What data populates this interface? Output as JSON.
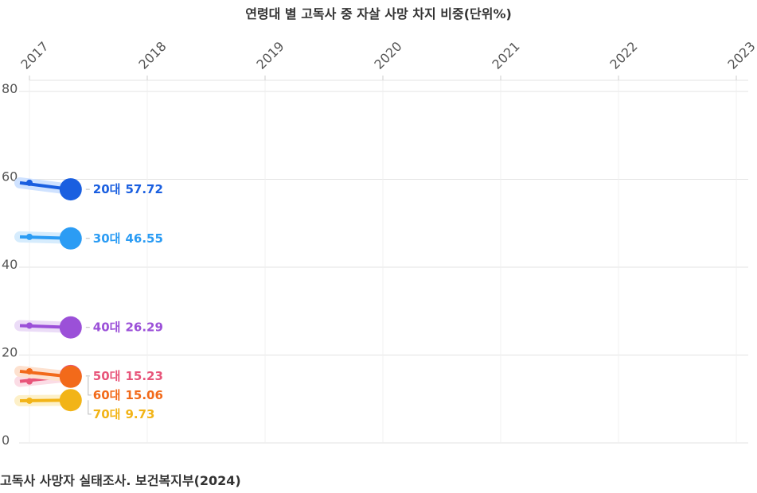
{
  "chart_data": {
    "type": "line",
    "title": "연령대 별 고독사 중 자살 사망 차지 비중(단위%)",
    "source": "고독사 사망자 실태조사. 보건복지부(2024)",
    "x_ticks": [
      "2017",
      "2018",
      "2019",
      "2020",
      "2021",
      "2022",
      "2023"
    ],
    "x_range": [
      2017,
      2023
    ],
    "ylim": [
      0,
      80
    ],
    "y_ticks": [
      "0",
      "20",
      "40",
      "60",
      "80"
    ],
    "grid": true,
    "animation_frame_x": 2017.35,
    "series": [
      {
        "name": "20대",
        "display": "57.72",
        "start": 59.2,
        "value": 57.72,
        "color": "#1a5fe0",
        "glow": "#cfe2ff"
      },
      {
        "name": "30대",
        "display": "46.55",
        "start": 46.9,
        "value": 46.55,
        "color": "#2b9cf4",
        "glow": "#d6ecfd"
      },
      {
        "name": "40대",
        "display": "26.29",
        "start": 26.7,
        "value": 26.29,
        "color": "#9b50d8",
        "glow": "#ebdcf7"
      },
      {
        "name": "50대",
        "display": "15.23",
        "start": 14.0,
        "value": 15.23,
        "color": "#e8557a",
        "glow": "#fbdce5"
      },
      {
        "name": "60대",
        "display": "15.06",
        "start": 16.3,
        "value": 15.06,
        "color": "#f26a1a",
        "glow": "#fde1cf"
      },
      {
        "name": "70대",
        "display": "9.73",
        "start": 9.6,
        "value": 9.73,
        "color": "#f2b417",
        "glow": "#fdf0c8"
      }
    ]
  }
}
